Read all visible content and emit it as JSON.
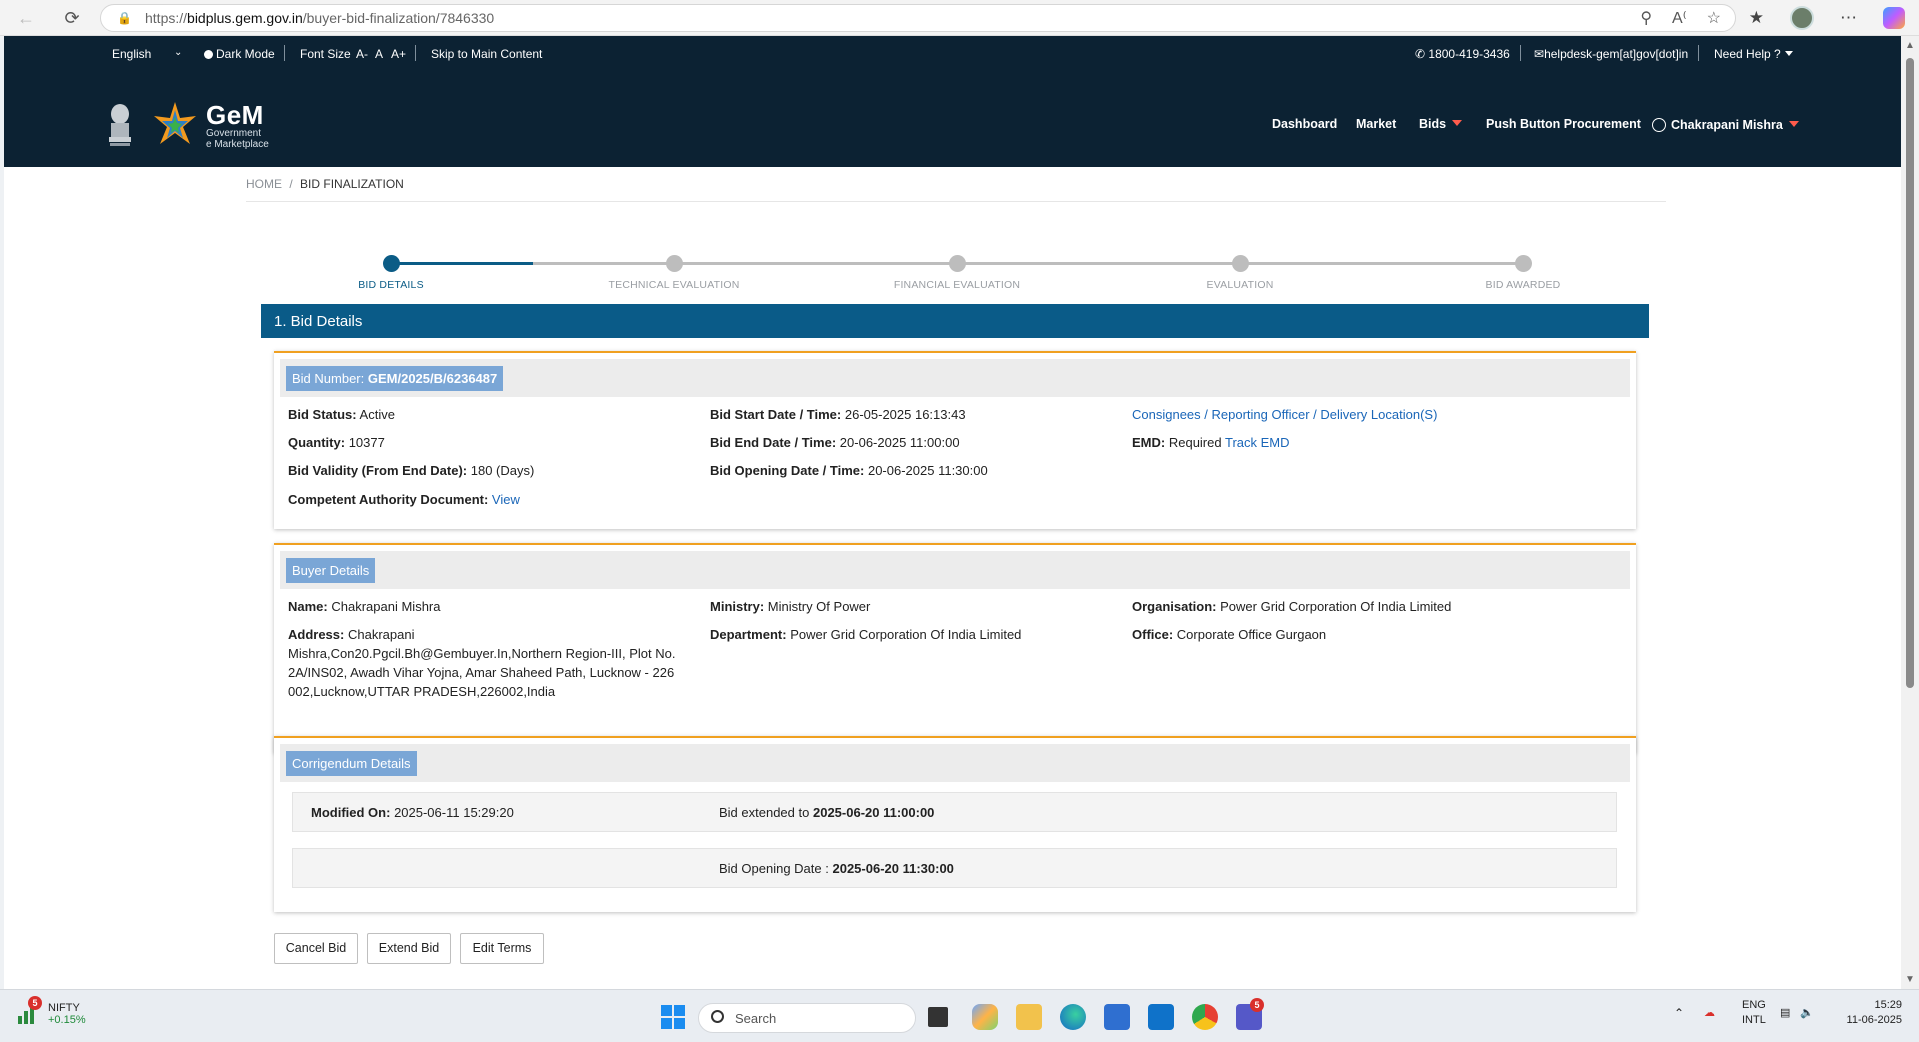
{
  "browser": {
    "url_prefix": "https://",
    "url_host": "bidplus.gem.gov.in",
    "url_path": "/buyer-bid-finalization/7846330"
  },
  "topbar": {
    "language": "English",
    "dark_mode": "Dark Mode",
    "font_size": "Font Size",
    "font_small": "A-",
    "font_normal": "A",
    "font_large": "A+",
    "skip": "Skip to Main Content",
    "phone": "1800-419-3436",
    "email": "helpdesk-gem[at]gov[dot]in",
    "help": "Need Help ?"
  },
  "logo": {
    "title": "GeM",
    "line1": "Government",
    "line2": "e Marketplace"
  },
  "nav": {
    "dashboard": "Dashboard",
    "market": "Market",
    "bids": "Bids",
    "push_button": "Push Button Procurement",
    "user": "Chakrapani Mishra"
  },
  "breadcrumb": {
    "home": "HOME",
    "separator": "/",
    "current": "BID FINALIZATION"
  },
  "stepper": {
    "steps": [
      "BID DETAILS",
      "TECHNICAL EVALUATION",
      "FINANCIAL EVALUATION",
      "EVALUATION",
      "BID AWARDED"
    ],
    "active_index": 0
  },
  "section_title": "1. Bid Details",
  "bid": {
    "number_label": "Bid Number:",
    "number": "GEM/2025/B/6236487",
    "status_label": "Bid Status:",
    "status": "Active",
    "quantity_label": "Quantity:",
    "quantity": "10377",
    "validity_label": "Bid Validity (From End Date):",
    "validity": "180 (Days)",
    "authority_label": "Competent Authority Document:",
    "authority_link": "View",
    "start_label": "Bid Start Date / Time:",
    "start": "26-05-2025 16:13:43",
    "end_label": "Bid End Date / Time:",
    "end": "20-06-2025 11:00:00",
    "opening_label": "Bid Opening Date / Time:",
    "opening": "20-06-2025 11:30:00",
    "consignees_link": "Consignees / Reporting Officer / Delivery Location(S)",
    "emd_label": "EMD:",
    "emd": "Required",
    "emd_link": "Track EMD"
  },
  "buyer": {
    "heading": "Buyer Details",
    "name_label": "Name:",
    "name": "Chakrapani Mishra",
    "address_label": "Address:",
    "address_line1": "Chakrapani",
    "address_line2": "Mishra,Con20.Pgcil.Bh@Gembuyer.In,Northern Region-III, Plot No.",
    "address_line3": "2A/INS02, Awadh Vihar Yojna, Amar Shaheed Path, Lucknow - 226",
    "address_line4": "002,Lucknow,UTTAR PRADESH,226002,India",
    "ministry_label": "Ministry:",
    "ministry": "Ministry Of Power",
    "department_label": "Department:",
    "department": "Power Grid Corporation Of India Limited",
    "organisation_label": "Organisation:",
    "organisation": "Power Grid Corporation Of India Limited",
    "office_label": "Office:",
    "office": "Corporate Office Gurgaon"
  },
  "corrigendum": {
    "heading": "Corrigendum Details",
    "modified_label": "Modified On:",
    "modified": "2025-06-11 15:29:20",
    "extended_label": "Bid extended to",
    "extended": "2025-06-20 11:00:00",
    "opening_label": "Bid Opening Date :",
    "opening": "2025-06-20 11:30:00"
  },
  "actions": {
    "cancel": "Cancel Bid",
    "extend": "Extend Bid",
    "edit": "Edit Terms"
  },
  "taskbar": {
    "nifty_name": "NIFTY",
    "nifty_change": "+0.15%",
    "nifty_badge": "5",
    "search": "Search",
    "teams_badge": "5",
    "lang1": "ENG",
    "lang2": "INTL",
    "time": "15:29",
    "date": "11-06-2025"
  },
  "colors": {
    "header_bg": "#0c2233",
    "section_bar": "#0a5b88",
    "accent_orange": "#f0a020",
    "pill_blue": "#7aa6d6",
    "link": "#1a66b8"
  }
}
